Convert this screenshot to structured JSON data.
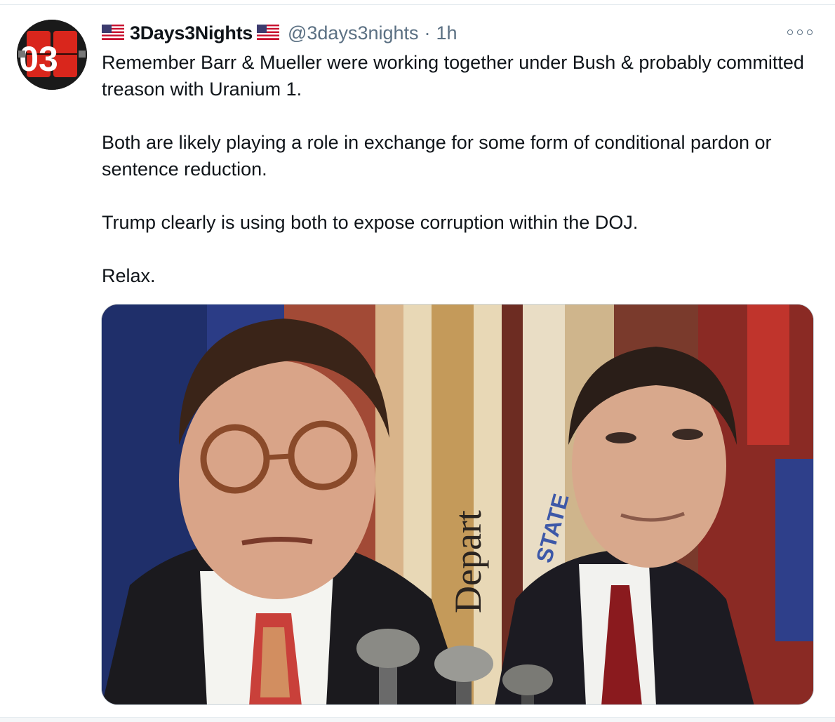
{
  "tweet": {
    "display_name": "3Days3Nights",
    "handle": "@3days3nights",
    "separator": "·",
    "timestamp": "1h",
    "paragraphs": [
      "Remember Barr & Mueller were working together under Bush & probably committed treason with Uranium 1.",
      "Both are likely playing a role in exchange for some form of conditional pardon or sentence reduction.",
      "Trump clearly is using both to expose corruption within the DOJ.",
      "Relax."
    ]
  },
  "avatar": {
    "digits": "03",
    "icon": "flip-clock-avatar-icon"
  },
  "flags": {
    "icon": "us-flag-icon"
  },
  "media": {
    "banner_text_1": "Depart",
    "banner_text_2": "STATE"
  },
  "colors": {
    "text": "#0f1419",
    "secondary": "#5b7083",
    "border": "#ccd6dd",
    "avatar_red": "#d9261c"
  }
}
